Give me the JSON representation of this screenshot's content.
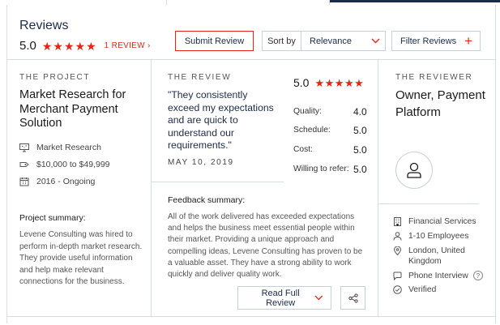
{
  "header": {
    "title": "Reviews",
    "rating": "5.0",
    "stars": 5,
    "review_count_link": "1 REVIEW ›",
    "submit_label": "Submit Review",
    "sort_label": "Sort by",
    "sort_value": "Relevance",
    "filter_label": "Filter Reviews",
    "filter_plus": "+"
  },
  "project": {
    "heading": "THE PROJECT",
    "title": "Market Research for Merchant Payment Solution",
    "service": "Market Research",
    "budget": "$10,000 to $49,999",
    "dates": "2016 - Ongoing",
    "summary_heading": "Project summary:",
    "summary": "Levene Consulting was hired to perform in-depth market research. They provide useful information and help make relevant connections for the business."
  },
  "review": {
    "heading": "THE REVIEW",
    "quote": "\"They consistently exceed my expectations and are quick to understand our requirements.\"",
    "date": "MAY 10, 2019",
    "overall": "5.0",
    "scores": [
      {
        "label": "Quality:",
        "value": "4.0"
      },
      {
        "label": "Schedule:",
        "value": "5.0"
      },
      {
        "label": "Cost:",
        "value": "5.0"
      },
      {
        "label": "Willing to refer:",
        "value": "5.0"
      }
    ],
    "feedback_heading": "Feedback summary:",
    "feedback": "All of the work delivered has exceeded expectations and helps the business meet essential people within their market. Providing a unique approach and compelling ideas, Levene Consulting has proven to be a valuable asset. They have a strong ability to work quickly and deliver quality work.",
    "read_full_label": "Read Full Review"
  },
  "reviewer": {
    "heading": "THE REVIEWER",
    "title": "Owner, Payment Platform",
    "industry": "Financial Services",
    "employees": "1-10 Employees",
    "location": "London, United Kingdom",
    "interview": "Phone Interview",
    "info_mark": "?",
    "verified": "Verified"
  },
  "colors": {
    "accent": "#e62415",
    "navy": "#1b2b4a",
    "border": "#d6dde3"
  }
}
